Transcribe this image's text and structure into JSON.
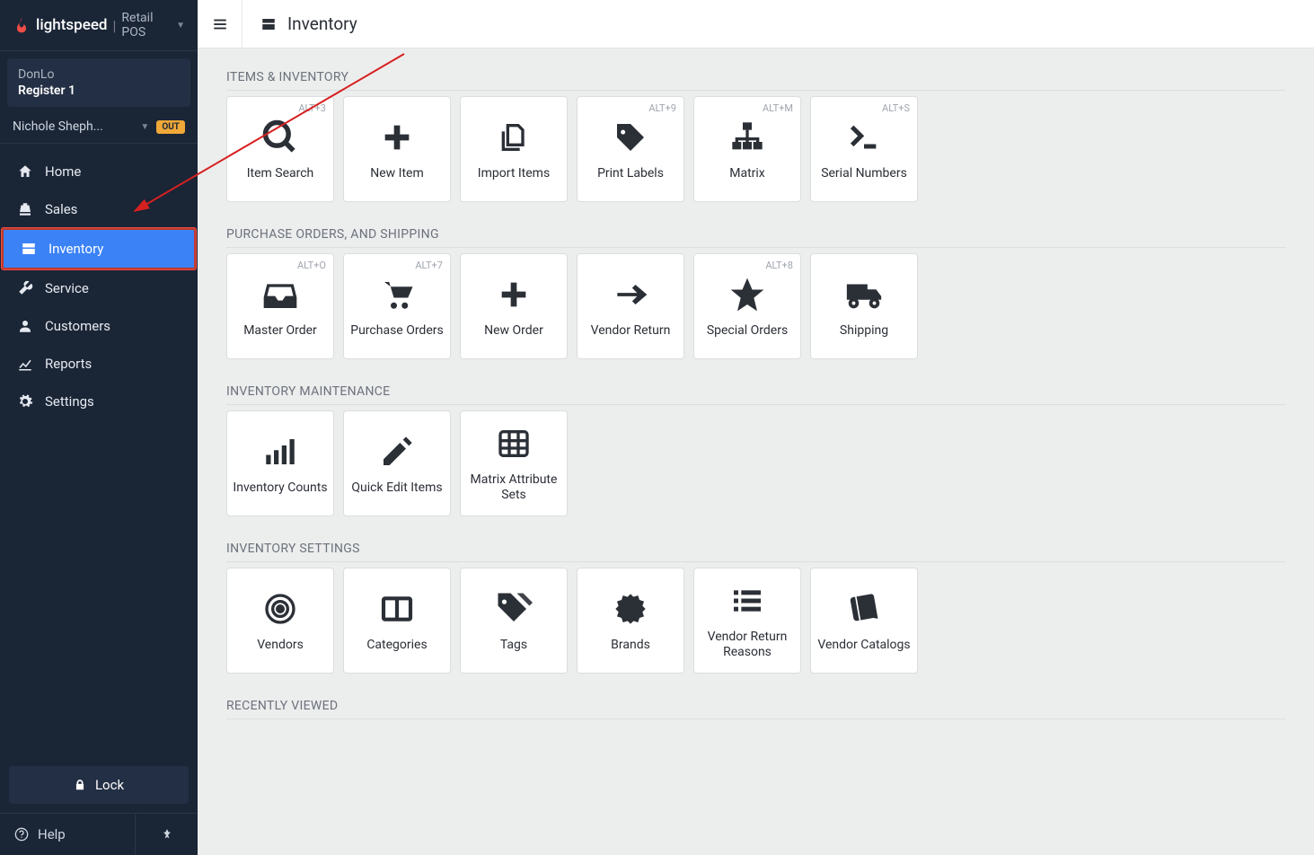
{
  "brand": {
    "name": "lightspeed",
    "product": "Retail POS"
  },
  "store": {
    "name": "DonLo",
    "register": "Register 1"
  },
  "user": {
    "name": "Nichole Sheph...",
    "status": "OUT"
  },
  "nav": {
    "home": "Home",
    "sales": "Sales",
    "inventory": "Inventory",
    "service": "Service",
    "customers": "Customers",
    "reports": "Reports",
    "settings": "Settings"
  },
  "footer": {
    "lock": "Lock",
    "help": "Help"
  },
  "header": {
    "title": "Inventory"
  },
  "sections": {
    "items": {
      "title": "ITEMS & INVENTORY",
      "tiles": {
        "item_search": {
          "label": "Item Search",
          "shortcut": "ALT+3"
        },
        "new_item": {
          "label": "New Item",
          "shortcut": ""
        },
        "import_items": {
          "label": "Import Items",
          "shortcut": ""
        },
        "print_labels": {
          "label": "Print Labels",
          "shortcut": "ALT+9"
        },
        "matrix": {
          "label": "Matrix",
          "shortcut": "ALT+M"
        },
        "serial_numbers": {
          "label": "Serial Numbers",
          "shortcut": "ALT+S"
        }
      }
    },
    "po": {
      "title": "PURCHASE ORDERS, AND SHIPPING",
      "tiles": {
        "master_order": {
          "label": "Master Order",
          "shortcut": "ALT+O"
        },
        "purchase_orders": {
          "label": "Purchase Orders",
          "shortcut": "ALT+7"
        },
        "new_order": {
          "label": "New Order",
          "shortcut": ""
        },
        "vendor_return": {
          "label": "Vendor Return",
          "shortcut": ""
        },
        "special_orders": {
          "label": "Special Orders",
          "shortcut": "ALT+8"
        },
        "shipping": {
          "label": "Shipping",
          "shortcut": ""
        }
      }
    },
    "maint": {
      "title": "INVENTORY MAINTENANCE",
      "tiles": {
        "inventory_counts": {
          "label": "Inventory Counts"
        },
        "quick_edit": {
          "label": "Quick Edit Items"
        },
        "matrix_attr": {
          "label": "Matrix Attribute Sets"
        }
      }
    },
    "settings": {
      "title": "INVENTORY SETTINGS",
      "tiles": {
        "vendors": {
          "label": "Vendors"
        },
        "categories": {
          "label": "Categories"
        },
        "tags": {
          "label": "Tags"
        },
        "brands": {
          "label": "Brands"
        },
        "return_reasons": {
          "label": "Vendor Return Reasons"
        },
        "vendor_catalogs": {
          "label": "Vendor Catalogs"
        }
      }
    },
    "recent": {
      "title": "RECENTLY VIEWED"
    }
  }
}
